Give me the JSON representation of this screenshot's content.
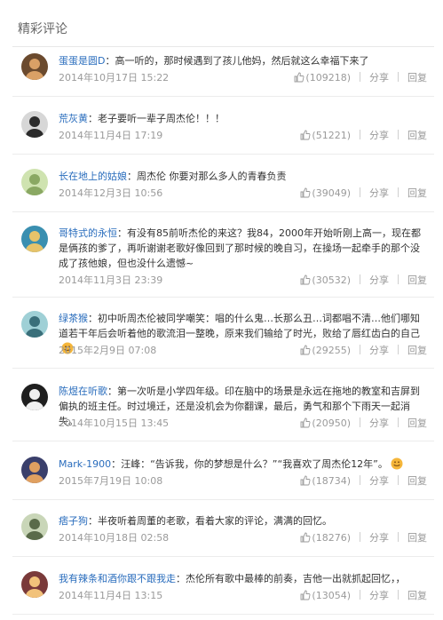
{
  "section_title": "精彩评论",
  "separator": "：",
  "labels": {
    "share": "分享",
    "reply": "回复"
  },
  "comments": [
    {
      "username": "蛋蛋是圆D",
      "text": "高一听的，那时候遇到了孩儿他妈，然后就这么幸福下来了",
      "time": "2014年10月17日 15:22",
      "likes": "(109218)",
      "avatar": {
        "bg": "#6b4a2e",
        "fg": "#d9a066"
      }
    },
    {
      "username": "荒灰黄",
      "text": "老子要听一辈子周杰伦！！！",
      "time": "2014年11月4日 17:19",
      "likes": "(51221)",
      "avatar": {
        "bg": "#d7d7d7",
        "fg": "#2b2b2b"
      }
    },
    {
      "username": "长在地上的姑娘",
      "text": "周杰伦 你要对那么多人的青春负责",
      "time": "2014年12月3日 10:56",
      "likes": "(39049)",
      "avatar": {
        "bg": "#cfe3b0",
        "fg": "#8aa863"
      }
    },
    {
      "username": "哥特式的永恒",
      "text": "有没有85前听杰伦的来这？我84，2000年开始听刚上高一，现在都是俩孩的爹了，再听谢谢老歌好像回到了那时候的晚自习，在操场一起牵手的那个没成了孩他娘，但也没什么遗憾~",
      "time": "2014年11月3日 23:39",
      "likes": "(30532)",
      "avatar": {
        "bg": "#3a8fb0",
        "fg": "#e6c36a"
      }
    },
    {
      "username": "绿茶猴",
      "text": "初中听周杰伦被同学嘲笑：唱的什么鬼…长那么丑…词都唱不清…他们哪知道若干年后会听着他的歌流泪一整晚，原来我们输给了时光，败给了唇红齿白的自己",
      "time": "2015年2月9日 07:08",
      "likes": "(29255)",
      "avatar": {
        "bg": "#9fd0d6",
        "fg": "#3a6f7a"
      }
    },
    {
      "username": "陈煜在听歌",
      "text": "第一次听是小学四年级。印在脑中的场景是永远在拖地的教室和吉屏到偏执的班主任。时过境迁，还是没机会为你翻课，最后，勇气和那个下雨天一起消失。",
      "time": "2014年10月15日 13:45",
      "likes": "(20950)",
      "avatar": {
        "bg": "#1f1f1f",
        "fg": "#f0f0f0"
      }
    },
    {
      "username": "Mark-1900",
      "text": "汪峰：“告诉我，你的梦想是什么？”“我喜欢了周杰伦12年”。",
      "time": "2015年7月19日 10:08",
      "likes": "(18734)",
      "avatar": {
        "bg": "#3a3f6b",
        "fg": "#e0a060"
      }
    },
    {
      "username": "痞子狗",
      "text": "半夜听着周董的老歌，看着大家的评论，满满的回忆。",
      "time": "2014年10月18日 02:58",
      "likes": "(18276)",
      "avatar": {
        "bg": "#c9d6b8",
        "fg": "#5a6b4a"
      }
    },
    {
      "username": "我有辣条和酒你跟不跟我走",
      "text": "杰伦所有歌中最棒的前奏，吉他一出就抓起回忆，，",
      "time": "2014年11月4日 13:15",
      "likes": "(13054)",
      "avatar": {
        "bg": "#7a3a3a",
        "fg": "#f2c27a"
      }
    }
  ]
}
